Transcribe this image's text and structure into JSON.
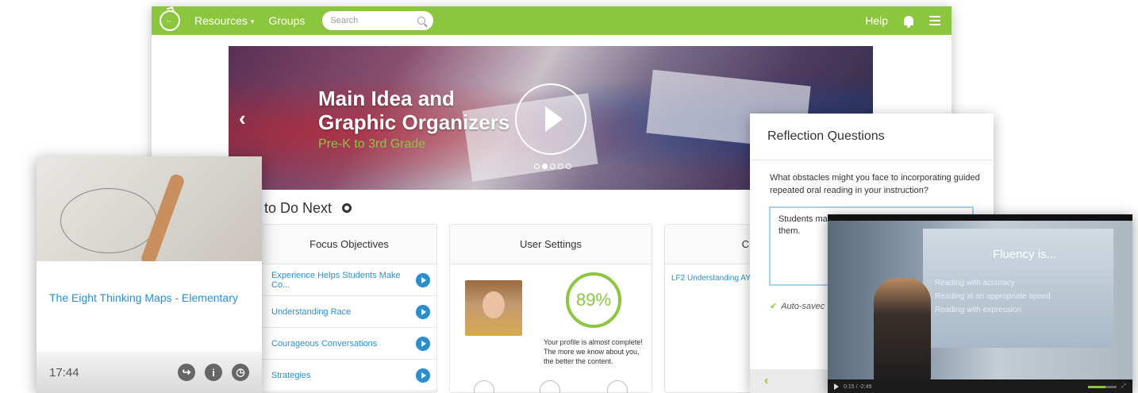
{
  "topbar": {
    "nav": [
      {
        "label": "Resources",
        "has_caret": true
      },
      {
        "label": "Groups",
        "has_caret": false
      }
    ],
    "search_placeholder": "Search",
    "help_label": "Help"
  },
  "hero": {
    "title_line1": "Main Idea and",
    "title_line2": "Graphic Organizers",
    "subtitle": "Pre-K to 3rd Grade",
    "prev_glyph": "‹",
    "slides_total": 5,
    "slide_active": 2
  },
  "todo": {
    "title": "to Do Next"
  },
  "focus_objectives": {
    "title": "Focus Objectives",
    "items": [
      "Experience Helps Students Make Co...",
      "Understanding Race",
      "Courageous Conversations",
      "Strategies"
    ]
  },
  "user_settings": {
    "title": "User Settings",
    "completion": "89%",
    "message": "Your profile is almost complete! The more we know about you, the better the content."
  },
  "third_panel": {
    "title_fragment": "C",
    "link": "LF2 Understanding AY"
  },
  "video_card": {
    "title": "The Eight Thinking Maps - Elementary",
    "duration": "17:44"
  },
  "reflection": {
    "title": "Reflection Questions",
    "question": "What obstacles might you face to incorporating guided repeated oral reading in your instruction?",
    "answer_line1": "Students ma",
    "answer_line2": "them.",
    "autosaved": "Auto-savec"
  },
  "video_player": {
    "slide_title": "Fluency is...",
    "bullets": [
      "Reading with accuracy",
      "Reading at an appropriate speed",
      "Reading with expression"
    ],
    "time": "0:15 / -2:49"
  },
  "colors": {
    "brand_green": "#8cc63f",
    "link_blue": "#2a8fd1"
  }
}
